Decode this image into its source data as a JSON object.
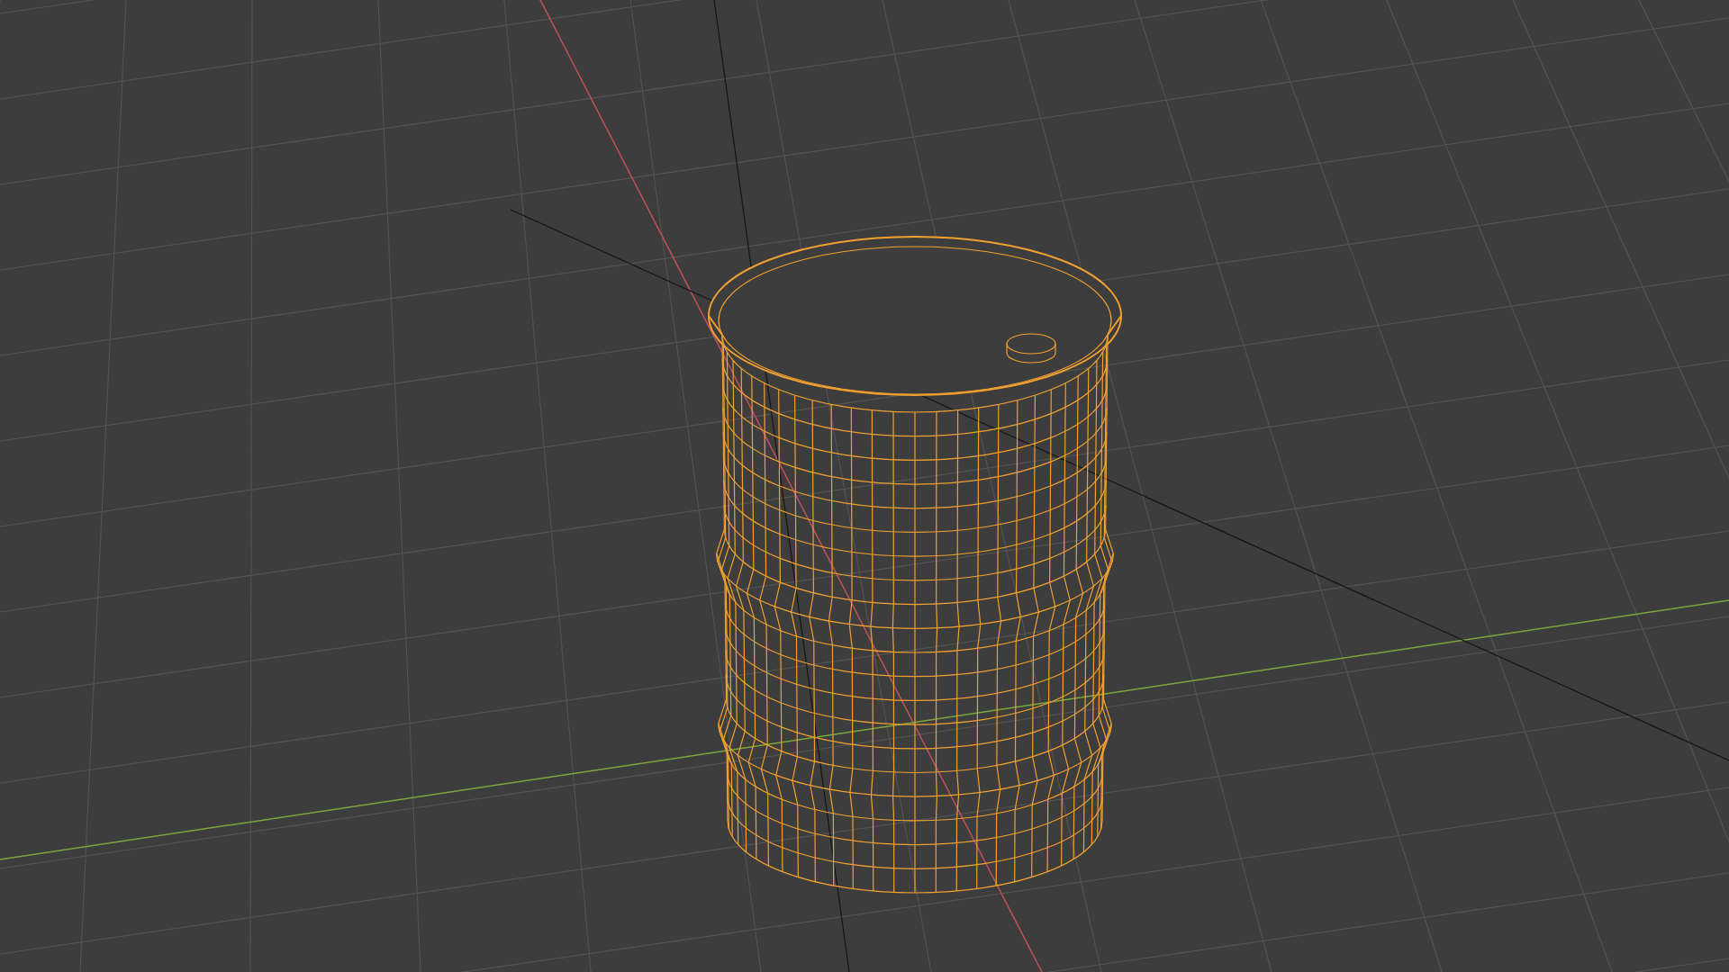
{
  "viewport": {
    "object": {
      "selected": true
    }
  }
}
